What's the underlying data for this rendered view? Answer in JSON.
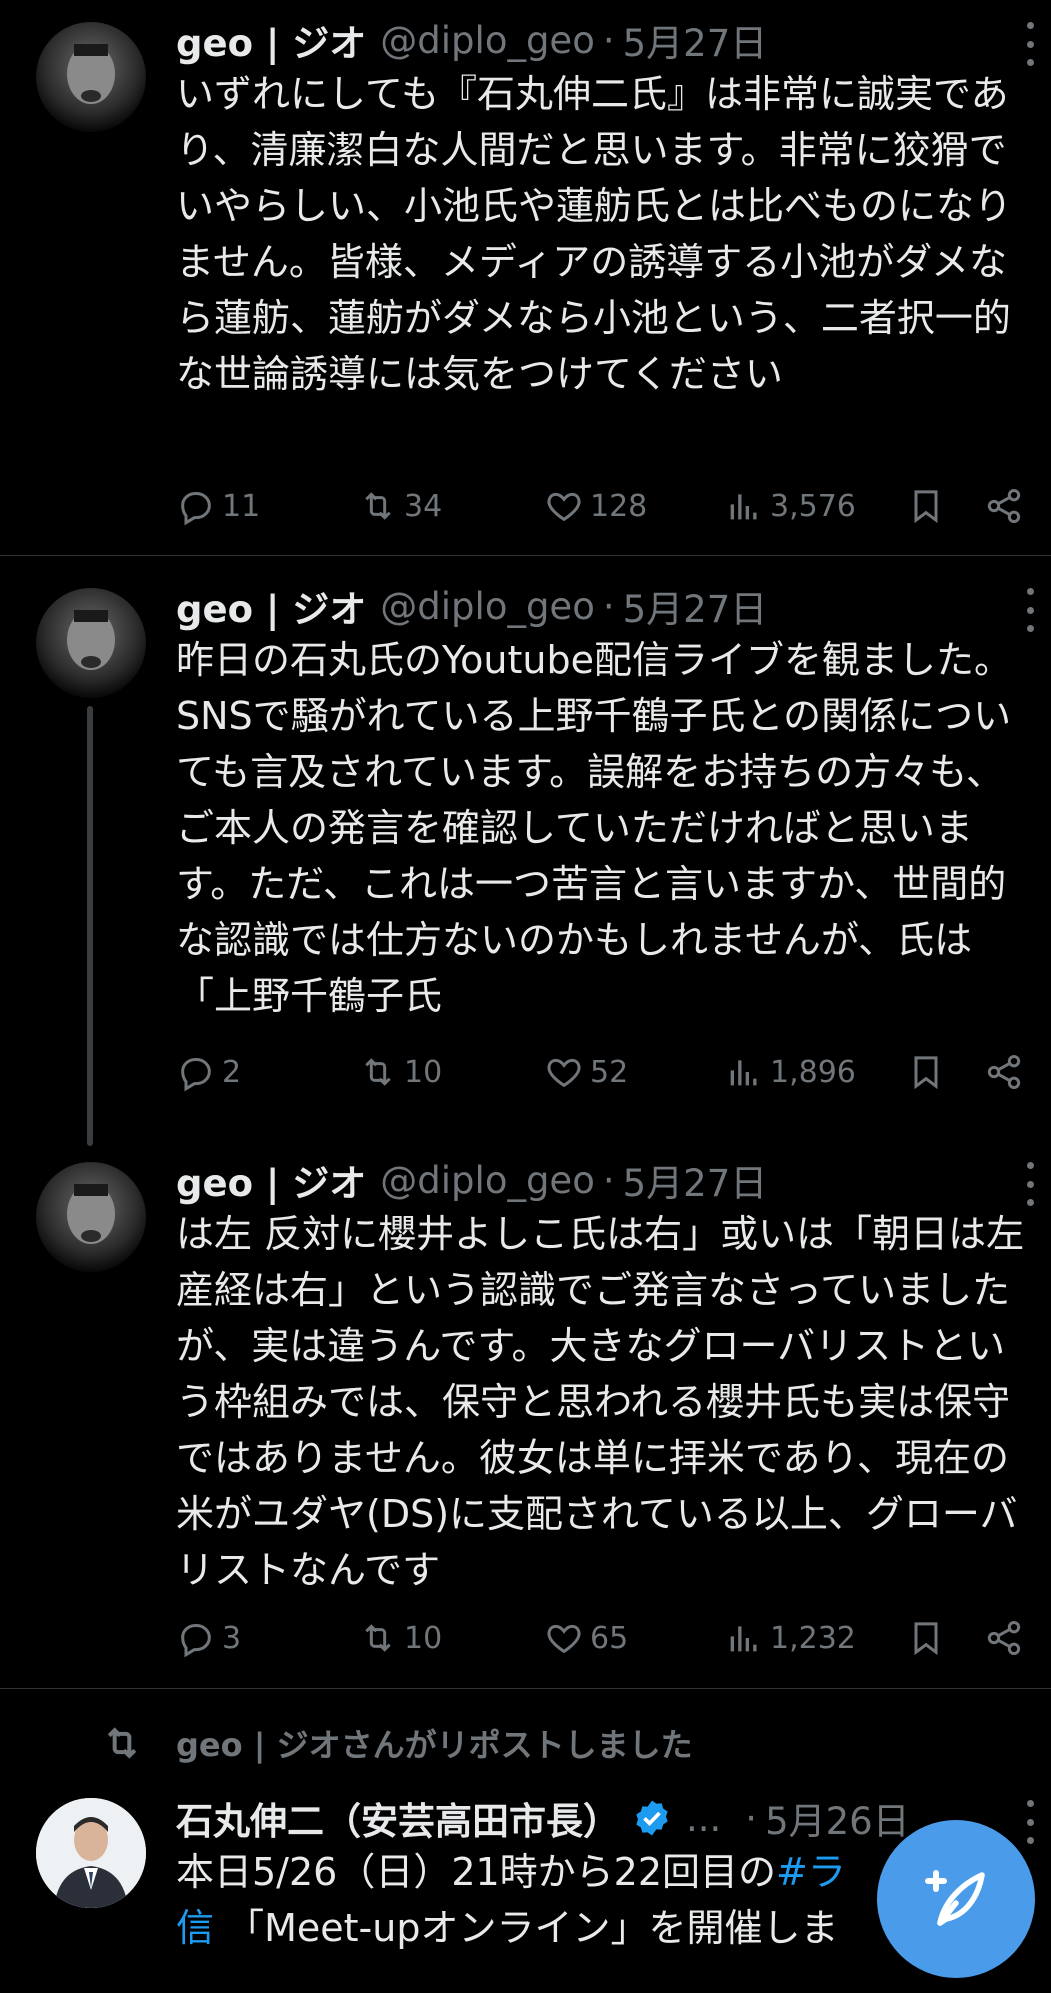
{
  "tweets": [
    {
      "name": "geo | ジオ",
      "handle": "@diplo_geo",
      "dot": "·",
      "date": "5月27日",
      "text": "いずれにしても『石丸伸二氏』は非常に誠実であり、清廉潔白な人間だと思います。非常に狡猾でいやらしい、小池氏や蓮舫氏とは比べものになりません。皆様、メディアの誘導する小池がダメなら蓮舫、蓮舫がダメなら小池という、二者択一的な世論誘導には気をつけてください",
      "replies": "11",
      "reposts": "34",
      "likes": "128",
      "views": "3,576"
    },
    {
      "name": "geo | ジオ",
      "handle": "@diplo_geo",
      "dot": "·",
      "date": "5月27日",
      "text": "昨日の石丸氏のYoutube配信ライブを観ました。SNSで騒がれている上野千鶴子氏との関係についても言及されています。誤解をお持ちの方々も、ご本人の発言を確認していただければと思います。ただ、これは一つ苦言と言いますか、世間的な認識では仕方ないのかもしれませんが、氏は「上野千鶴子氏",
      "replies": "2",
      "reposts": "10",
      "likes": "52",
      "views": "1,896"
    },
    {
      "name": "geo | ジオ",
      "handle": "@diplo_geo",
      "dot": "·",
      "date": "5月27日",
      "text": "は左 反対に櫻井よしこ氏は右」或いは「朝日は左 産経は右」という認識でご発言なさっていましたが、実は違うんです。大きなグローバリストという枠組みでは、保守と思われる櫻井氏も実は保守ではありません。彼女は単に拝米であり、現在の米がユダヤ(DS)に支配されている以上、グローバリストなんです",
      "replies": "3",
      "reposts": "10",
      "likes": "65",
      "views": "1,232"
    }
  ],
  "repost_banner": "geo | ジオさんがリポストしました",
  "last_tweet": {
    "name": "石丸伸二（安芸高田市長）",
    "ellipsis": "...",
    "dot": "·",
    "date": "5月26日",
    "text_plain": "本日5/26（日）21時から22回目の",
    "text_link": "#ラ",
    "text_line2_link": "信",
    "text_line2_plain": " 「Meet-upオンライン」を開催しま"
  },
  "colors": {
    "background": "#000000",
    "text": "#e7e9ea",
    "muted": "#71767b",
    "accent": "#1d9bf0",
    "fab": "#4a9cea"
  },
  "icons": [
    "reply-icon",
    "repost-icon",
    "like-icon",
    "views-icon",
    "bookmark-icon",
    "share-icon",
    "more-icon",
    "verified-icon",
    "compose-icon"
  ]
}
